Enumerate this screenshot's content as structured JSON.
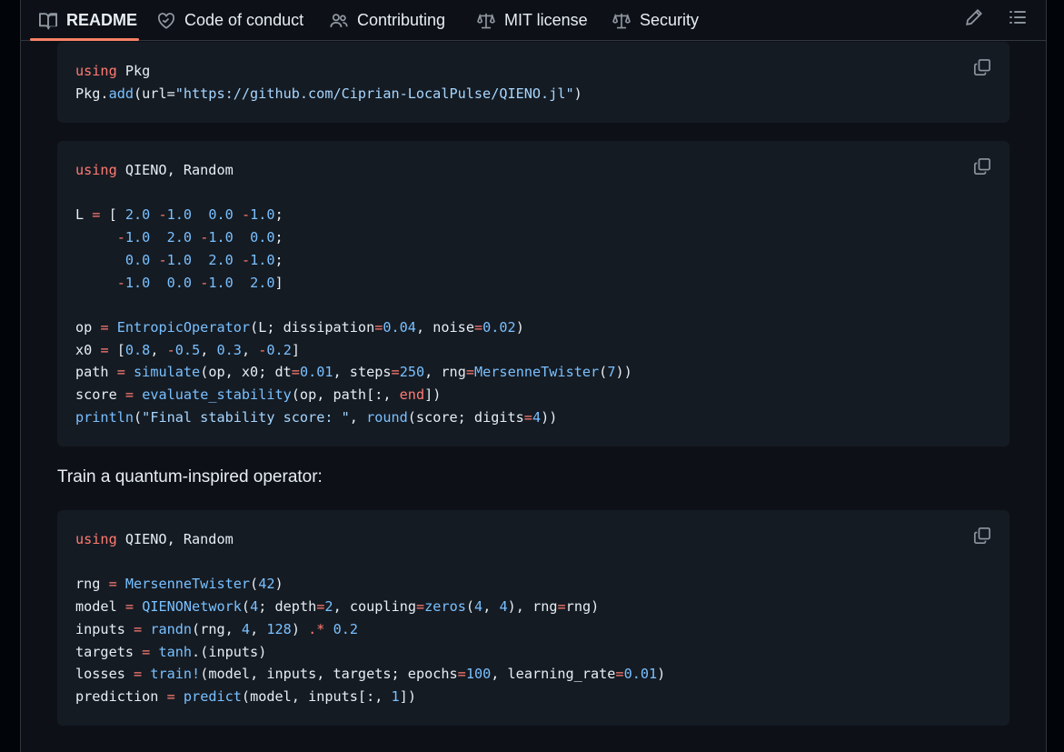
{
  "tabs": [
    {
      "label": "README",
      "icon": "book-icon",
      "active": true
    },
    {
      "label": "Code of conduct",
      "icon": "heart-icon"
    },
    {
      "label": "Contributing",
      "icon": "people-icon"
    },
    {
      "label": "MIT license",
      "icon": "scale-icon"
    },
    {
      "label": "Security",
      "icon": "scale-icon"
    }
  ],
  "toolbar": {
    "edit_icon": "pencil-icon",
    "outline_icon": "list-icon"
  },
  "code_blocks": [
    {
      "lines": [
        [
          [
            "using",
            "k"
          ],
          [
            " Pkg",
            ""
          ]
        ],
        [
          [
            "Pkg.",
            ""
          ],
          [
            "add",
            "b"
          ],
          [
            "(url=",
            ""
          ],
          [
            "\"https://github.com/Ciprian-LocalPulse/QIENO.jl\"",
            "s"
          ],
          [
            ")",
            ""
          ]
        ]
      ]
    },
    {
      "lines": [
        [
          [
            "using",
            "k"
          ],
          [
            " QIENO, Random",
            ""
          ]
        ],
        [],
        [
          [
            "L ",
            ""
          ],
          [
            "=",
            "k"
          ],
          [
            " [ ",
            ""
          ],
          [
            "2.0",
            "b"
          ],
          [
            " ",
            ""
          ],
          [
            "-",
            "k"
          ],
          [
            "1.0",
            "b"
          ],
          [
            "  ",
            ""
          ],
          [
            "0.0",
            "b"
          ],
          [
            " ",
            ""
          ],
          [
            "-",
            "k"
          ],
          [
            "1.0",
            "b"
          ],
          [
            ";",
            ""
          ]
        ],
        [
          [
            "     ",
            ""
          ],
          [
            "-",
            "k"
          ],
          [
            "1.0",
            "b"
          ],
          [
            "  ",
            ""
          ],
          [
            "2.0",
            "b"
          ],
          [
            " ",
            ""
          ],
          [
            "-",
            "k"
          ],
          [
            "1.0",
            "b"
          ],
          [
            "  ",
            ""
          ],
          [
            "0.0",
            "b"
          ],
          [
            ";",
            ""
          ]
        ],
        [
          [
            "      ",
            ""
          ],
          [
            "0.0",
            "b"
          ],
          [
            " ",
            ""
          ],
          [
            "-",
            "k"
          ],
          [
            "1.0",
            "b"
          ],
          [
            "  ",
            ""
          ],
          [
            "2.0",
            "b"
          ],
          [
            " ",
            ""
          ],
          [
            "-",
            "k"
          ],
          [
            "1.0",
            "b"
          ],
          [
            ";",
            ""
          ]
        ],
        [
          [
            "     ",
            ""
          ],
          [
            "-",
            "k"
          ],
          [
            "1.0",
            "b"
          ],
          [
            "  ",
            ""
          ],
          [
            "0.0",
            "b"
          ],
          [
            " ",
            ""
          ],
          [
            "-",
            "k"
          ],
          [
            "1.0",
            "b"
          ],
          [
            "  ",
            ""
          ],
          [
            "2.0",
            "b"
          ],
          [
            "]",
            ""
          ]
        ],
        [],
        [
          [
            "op ",
            ""
          ],
          [
            "=",
            "k"
          ],
          [
            " ",
            ""
          ],
          [
            "EntropicOperator",
            "b"
          ],
          [
            "(L; dissipation",
            ""
          ],
          [
            "=",
            "k"
          ],
          [
            "0.04",
            "b"
          ],
          [
            ", noise",
            ""
          ],
          [
            "=",
            "k"
          ],
          [
            "0.02",
            "b"
          ],
          [
            ")",
            ""
          ]
        ],
        [
          [
            "x0 ",
            ""
          ],
          [
            "=",
            "k"
          ],
          [
            " [",
            ""
          ],
          [
            "0.8",
            "b"
          ],
          [
            ", ",
            ""
          ],
          [
            "-",
            "k"
          ],
          [
            "0.5",
            "b"
          ],
          [
            ", ",
            ""
          ],
          [
            "0.3",
            "b"
          ],
          [
            ", ",
            ""
          ],
          [
            "-",
            "k"
          ],
          [
            "0.2",
            "b"
          ],
          [
            "]",
            ""
          ]
        ],
        [
          [
            "path ",
            ""
          ],
          [
            "=",
            "k"
          ],
          [
            " ",
            ""
          ],
          [
            "simulate",
            "b"
          ],
          [
            "(op, x0; dt",
            ""
          ],
          [
            "=",
            "k"
          ],
          [
            "0.01",
            "b"
          ],
          [
            ", steps",
            ""
          ],
          [
            "=",
            "k"
          ],
          [
            "250",
            "b"
          ],
          [
            ", rng",
            ""
          ],
          [
            "=",
            "k"
          ],
          [
            "MersenneTwister",
            "b"
          ],
          [
            "(",
            ""
          ],
          [
            "7",
            "b"
          ],
          [
            "))",
            ""
          ]
        ],
        [
          [
            "score ",
            ""
          ],
          [
            "=",
            "k"
          ],
          [
            " ",
            ""
          ],
          [
            "evaluate_stability",
            "b"
          ],
          [
            "(op, path[:, ",
            ""
          ],
          [
            "end",
            "k"
          ],
          [
            "])",
            ""
          ]
        ],
        [
          [
            "println",
            "b"
          ],
          [
            "(",
            ""
          ],
          [
            "\"Final stability score: \"",
            "s"
          ],
          [
            ", ",
            ""
          ],
          [
            "round",
            "b"
          ],
          [
            "(score; digits",
            ""
          ],
          [
            "=",
            "k"
          ],
          [
            "4",
            "b"
          ],
          [
            "))",
            ""
          ]
        ]
      ]
    },
    {
      "lines": [
        [
          [
            "using",
            "k"
          ],
          [
            " QIENO, Random",
            ""
          ]
        ],
        [],
        [
          [
            "rng ",
            ""
          ],
          [
            "=",
            "k"
          ],
          [
            " ",
            ""
          ],
          [
            "MersenneTwister",
            "b"
          ],
          [
            "(",
            ""
          ],
          [
            "42",
            "b"
          ],
          [
            ")",
            ""
          ]
        ],
        [
          [
            "model ",
            ""
          ],
          [
            "=",
            "k"
          ],
          [
            " ",
            ""
          ],
          [
            "QIENONetwork",
            "b"
          ],
          [
            "(",
            ""
          ],
          [
            "4",
            "b"
          ],
          [
            "; depth",
            ""
          ],
          [
            "=",
            "k"
          ],
          [
            "2",
            "b"
          ],
          [
            ", coupling",
            ""
          ],
          [
            "=",
            "k"
          ],
          [
            "zeros",
            "b"
          ],
          [
            "(",
            ""
          ],
          [
            "4",
            "b"
          ],
          [
            ", ",
            ""
          ],
          [
            "4",
            "b"
          ],
          [
            "), rng",
            ""
          ],
          [
            "=",
            "k"
          ],
          [
            "rng)",
            ""
          ]
        ],
        [
          [
            "inputs ",
            ""
          ],
          [
            "=",
            "k"
          ],
          [
            " ",
            ""
          ],
          [
            "randn",
            "b"
          ],
          [
            "(rng, ",
            ""
          ],
          [
            "4",
            "b"
          ],
          [
            ", ",
            ""
          ],
          [
            "128",
            "b"
          ],
          [
            ") ",
            ""
          ],
          [
            ".*",
            "k"
          ],
          [
            " ",
            ""
          ],
          [
            "0.2",
            "b"
          ]
        ],
        [
          [
            "targets ",
            ""
          ],
          [
            "=",
            "k"
          ],
          [
            " ",
            ""
          ],
          [
            "tanh",
            "b"
          ],
          [
            ".(inputs)",
            ""
          ]
        ],
        [
          [
            "losses ",
            ""
          ],
          [
            "=",
            "k"
          ],
          [
            " ",
            ""
          ],
          [
            "train!",
            "b"
          ],
          [
            "(model, inputs, targets; epochs",
            ""
          ],
          [
            "=",
            "k"
          ],
          [
            "100",
            "b"
          ],
          [
            ", learning_rate",
            ""
          ],
          [
            "=",
            "k"
          ],
          [
            "0.01",
            "b"
          ],
          [
            ")",
            ""
          ]
        ],
        [
          [
            "prediction ",
            ""
          ],
          [
            "=",
            "k"
          ],
          [
            " ",
            ""
          ],
          [
            "predict",
            "b"
          ],
          [
            "(model, inputs[:, ",
            ""
          ],
          [
            "1",
            "b"
          ],
          [
            "])",
            ""
          ]
        ]
      ]
    }
  ],
  "paragraph": "Train a quantum-inspired operator:",
  "colors": {
    "keyword": "#ff7b72",
    "builtin": "#79c0ff",
    "string": "#a5d6ff",
    "text": "#e6edf3",
    "code_bg": "#151b23",
    "tab_underline": "#f78166"
  }
}
